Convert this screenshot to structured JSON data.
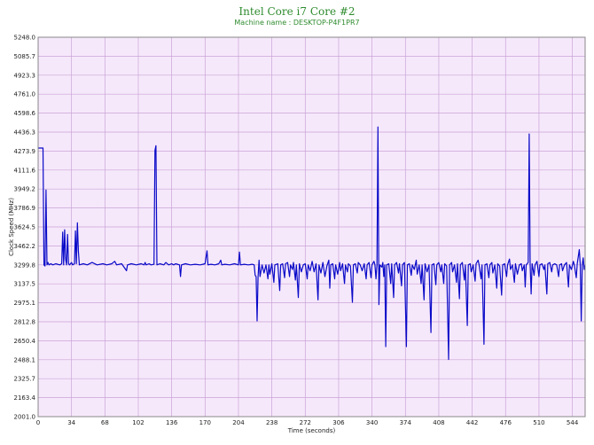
{
  "chart_data": {
    "type": "line",
    "title": "Intel Core i7 Core #2",
    "subtitle": "Machine name : DESKTOP-P4F1PR7",
    "xlabel": "Time (seconds)",
    "ylabel": "Clock Speed (MHz)",
    "xlim": [
      0,
      557
    ],
    "ylim": [
      2001.0,
      5248.0
    ],
    "x_ticks": [
      0,
      34,
      68,
      102,
      136,
      170,
      204,
      238,
      272,
      306,
      340,
      374,
      408,
      442,
      476,
      510,
      544
    ],
    "y_ticks": [
      2001.0,
      2163.4,
      2325.7,
      2488.1,
      2650.4,
      2812.8,
      2975.1,
      3137.5,
      3299.8,
      3462.2,
      3624.5,
      3786.9,
      3949.2,
      4111.6,
      4273.9,
      4436.3,
      4598.6,
      4761.0,
      4923.3,
      5085.7,
      5248.0
    ],
    "grid": true,
    "colors": {
      "background": "#f6e8fb",
      "grid": "#c9a4d6",
      "line": "#0a0ac8",
      "frame": "#888888"
    },
    "series": [
      {
        "values": [
          [
            0,
            4300
          ],
          [
            4,
            4300
          ],
          [
            5,
            4300
          ],
          [
            6,
            3300
          ],
          [
            7,
            3290
          ],
          [
            8,
            3940
          ],
          [
            9,
            3300
          ],
          [
            10,
            3320
          ],
          [
            11,
            3300
          ],
          [
            13,
            3310
          ],
          [
            15,
            3300
          ],
          [
            18,
            3310
          ],
          [
            22,
            3300
          ],
          [
            24,
            3310
          ],
          [
            25,
            3580
          ],
          [
            26,
            3300
          ],
          [
            27,
            3600
          ],
          [
            28,
            3350
          ],
          [
            29,
            3300
          ],
          [
            30,
            3560
          ],
          [
            31,
            3310
          ],
          [
            32,
            3300
          ],
          [
            34,
            3320
          ],
          [
            35,
            3300
          ],
          [
            37,
            3310
          ],
          [
            38,
            3590
          ],
          [
            39,
            3310
          ],
          [
            40,
            3660
          ],
          [
            41,
            3420
          ],
          [
            42,
            3300
          ],
          [
            46,
            3310
          ],
          [
            50,
            3300
          ],
          [
            55,
            3320
          ],
          [
            60,
            3300
          ],
          [
            66,
            3310
          ],
          [
            70,
            3300
          ],
          [
            75,
            3310
          ],
          [
            78,
            3330
          ],
          [
            80,
            3300
          ],
          [
            85,
            3310
          ],
          [
            90,
            3250
          ],
          [
            91,
            3300
          ],
          [
            95,
            3310
          ],
          [
            100,
            3300
          ],
          [
            105,
            3310
          ],
          [
            108,
            3300
          ],
          [
            109,
            3320
          ],
          [
            110,
            3300
          ],
          [
            113,
            3310
          ],
          [
            115,
            3300
          ],
          [
            118,
            3305
          ],
          [
            119,
            4280
          ],
          [
            120,
            4320
          ],
          [
            121,
            3300
          ],
          [
            124,
            3310
          ],
          [
            128,
            3300
          ],
          [
            130,
            3320
          ],
          [
            133,
            3300
          ],
          [
            136,
            3310
          ],
          [
            138,
            3300
          ],
          [
            140,
            3310
          ],
          [
            144,
            3300
          ],
          [
            145,
            3200
          ],
          [
            146,
            3300
          ],
          [
            150,
            3310
          ],
          [
            155,
            3300
          ],
          [
            160,
            3305
          ],
          [
            165,
            3300
          ],
          [
            170,
            3310
          ],
          [
            172,
            3420
          ],
          [
            173,
            3300
          ],
          [
            176,
            3305
          ],
          [
            180,
            3300
          ],
          [
            184,
            3310
          ],
          [
            186,
            3340
          ],
          [
            187,
            3300
          ],
          [
            190,
            3305
          ],
          [
            195,
            3300
          ],
          [
            200,
            3310
          ],
          [
            204,
            3300
          ],
          [
            205,
            3410
          ],
          [
            206,
            3300
          ],
          [
            210,
            3305
          ],
          [
            214,
            3300
          ],
          [
            218,
            3305
          ],
          [
            220,
            3300
          ],
          [
            221,
            3210
          ],
          [
            222,
            3200
          ],
          [
            223,
            2820
          ],
          [
            224,
            3200
          ],
          [
            225,
            3340
          ],
          [
            226,
            3200
          ],
          [
            228,
            3300
          ],
          [
            230,
            3230
          ],
          [
            232,
            3300
          ],
          [
            234,
            3180
          ],
          [
            235,
            3300
          ],
          [
            236,
            3220
          ],
          [
            238,
            3310
          ],
          [
            240,
            3150
          ],
          [
            241,
            3300
          ],
          [
            244,
            3310
          ],
          [
            246,
            3080
          ],
          [
            247,
            3300
          ],
          [
            249,
            3310
          ],
          [
            251,
            3190
          ],
          [
            252,
            3310
          ],
          [
            254,
            3320
          ],
          [
            256,
            3200
          ],
          [
            257,
            3300
          ],
          [
            259,
            3260
          ],
          [
            260,
            3320
          ],
          [
            262,
            3170
          ],
          [
            263,
            3300
          ],
          [
            265,
            3020
          ],
          [
            266,
            3310
          ],
          [
            268,
            3240
          ],
          [
            270,
            3300
          ],
          [
            272,
            3310
          ],
          [
            274,
            3180
          ],
          [
            275,
            3300
          ],
          [
            277,
            3250
          ],
          [
            279,
            3330
          ],
          [
            281,
            3240
          ],
          [
            283,
            3310
          ],
          [
            285,
            3000
          ],
          [
            286,
            3300
          ],
          [
            288,
            3230
          ],
          [
            290,
            3320
          ],
          [
            292,
            3200
          ],
          [
            294,
            3290
          ],
          [
            296,
            3340
          ],
          [
            297,
            3100
          ],
          [
            298,
            3300
          ],
          [
            300,
            3310
          ],
          [
            302,
            3180
          ],
          [
            303,
            3300
          ],
          [
            305,
            3220
          ],
          [
            307,
            3320
          ],
          [
            308,
            3250
          ],
          [
            310,
            3310
          ],
          [
            312,
            3140
          ],
          [
            313,
            3300
          ],
          [
            315,
            3240
          ],
          [
            316,
            3310
          ],
          [
            318,
            3290
          ],
          [
            320,
            2980
          ],
          [
            321,
            3300
          ],
          [
            323,
            3310
          ],
          [
            325,
            3230
          ],
          [
            326,
            3320
          ],
          [
            328,
            3300
          ],
          [
            330,
            3250
          ],
          [
            332,
            3310
          ],
          [
            334,
            3180
          ],
          [
            335,
            3300
          ],
          [
            337,
            3320
          ],
          [
            339,
            3190
          ],
          [
            340,
            3300
          ],
          [
            342,
            3330
          ],
          [
            343,
            3300
          ],
          [
            344,
            3180
          ],
          [
            345,
            3300
          ],
          [
            346,
            4480
          ],
          [
            347,
            2960
          ],
          [
            348,
            3300
          ],
          [
            350,
            3280
          ],
          [
            351,
            3320
          ],
          [
            352,
            3200
          ],
          [
            353,
            3300
          ],
          [
            354,
            2600
          ],
          [
            355,
            3300
          ],
          [
            357,
            3310
          ],
          [
            359,
            3140
          ],
          [
            360,
            3310
          ],
          [
            362,
            3020
          ],
          [
            363,
            3300
          ],
          [
            365,
            3320
          ],
          [
            367,
            3230
          ],
          [
            368,
            3310
          ],
          [
            370,
            3120
          ],
          [
            371,
            3300
          ],
          [
            373,
            3320
          ],
          [
            375,
            2600
          ],
          [
            376,
            3300
          ],
          [
            378,
            3310
          ],
          [
            380,
            3210
          ],
          [
            381,
            3300
          ],
          [
            383,
            3260
          ],
          [
            385,
            3340
          ],
          [
            386,
            3220
          ],
          [
            388,
            3300
          ],
          [
            390,
            3140
          ],
          [
            391,
            3300
          ],
          [
            393,
            3000
          ],
          [
            394,
            3310
          ],
          [
            396,
            3240
          ],
          [
            398,
            3300
          ],
          [
            400,
            2720
          ],
          [
            401,
            3300
          ],
          [
            403,
            3310
          ],
          [
            405,
            3130
          ],
          [
            406,
            3300
          ],
          [
            408,
            3320
          ],
          [
            410,
            3240
          ],
          [
            411,
            3300
          ],
          [
            413,
            3140
          ],
          [
            414,
            3310
          ],
          [
            416,
            3290
          ],
          [
            418,
            2490
          ],
          [
            419,
            3300
          ],
          [
            421,
            3320
          ],
          [
            422,
            3240
          ],
          [
            424,
            3300
          ],
          [
            426,
            3150
          ],
          [
            427,
            3310
          ],
          [
            429,
            3010
          ],
          [
            430,
            3300
          ],
          [
            432,
            3320
          ],
          [
            434,
            3170
          ],
          [
            435,
            3300
          ],
          [
            437,
            2780
          ],
          [
            438,
            3300
          ],
          [
            440,
            3310
          ],
          [
            441,
            3240
          ],
          [
            443,
            3300
          ],
          [
            445,
            3160
          ],
          [
            446,
            3310
          ],
          [
            448,
            3340
          ],
          [
            449,
            3300
          ],
          [
            451,
            3180
          ],
          [
            452,
            3300
          ],
          [
            454,
            2620
          ],
          [
            455,
            3300
          ],
          [
            457,
            3310
          ],
          [
            459,
            3190
          ],
          [
            460,
            3300
          ],
          [
            462,
            3320
          ],
          [
            463,
            3230
          ],
          [
            465,
            3300
          ],
          [
            467,
            3100
          ],
          [
            468,
            3310
          ],
          [
            470,
            3290
          ],
          [
            472,
            3040
          ],
          [
            473,
            3300
          ],
          [
            475,
            3310
          ],
          [
            477,
            3200
          ],
          [
            478,
            3300
          ],
          [
            480,
            3350
          ],
          [
            481,
            3260
          ],
          [
            483,
            3300
          ],
          [
            485,
            3150
          ],
          [
            486,
            3310
          ],
          [
            488,
            3220
          ],
          [
            490,
            3300
          ],
          [
            492,
            3310
          ],
          [
            493,
            3250
          ],
          [
            495,
            3300
          ],
          [
            496,
            3110
          ],
          [
            497,
            3300
          ],
          [
            499,
            3320
          ],
          [
            500,
            4420
          ],
          [
            501,
            3300
          ],
          [
            502,
            3050
          ],
          [
            503,
            3310
          ],
          [
            505,
            3210
          ],
          [
            506,
            3300
          ],
          [
            508,
            3330
          ],
          [
            510,
            3200
          ],
          [
            511,
            3300
          ],
          [
            513,
            3310
          ],
          [
            515,
            3260
          ],
          [
            516,
            3300
          ],
          [
            518,
            3050
          ],
          [
            519,
            3310
          ],
          [
            521,
            3320
          ],
          [
            523,
            3240
          ],
          [
            524,
            3300
          ],
          [
            526,
            3310
          ],
          [
            528,
            3300
          ],
          [
            530,
            3200
          ],
          [
            531,
            3300
          ],
          [
            533,
            3310
          ],
          [
            534,
            3250
          ],
          [
            536,
            3300
          ],
          [
            538,
            3320
          ],
          [
            540,
            3110
          ],
          [
            541,
            3300
          ],
          [
            543,
            3260
          ],
          [
            545,
            3330
          ],
          [
            546,
            3300
          ],
          [
            548,
            3190
          ],
          [
            549,
            3310
          ],
          [
            551,
            3430
          ],
          [
            552,
            3300
          ],
          [
            553,
            2820
          ],
          [
            554,
            3300
          ],
          [
            555,
            3360
          ],
          [
            556,
            3260
          ],
          [
            557,
            3300
          ]
        ]
      }
    ]
  }
}
